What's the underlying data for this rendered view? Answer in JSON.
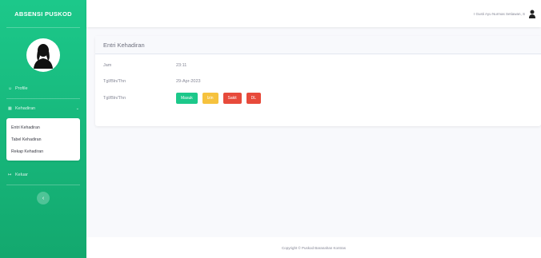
{
  "sidebar": {
    "brand": "ABSENSI PUSKOD",
    "items": [
      {
        "label": "Profile",
        "icon": "user-icon"
      },
      {
        "label": "Kehadiran",
        "icon": "calendar-icon"
      },
      {
        "label": "Keluar",
        "icon": "logout-icon"
      }
    ],
    "submenu": [
      "Entri Kehadiran",
      "Tabel Kehadiran",
      "Rekap Kehadiran"
    ],
    "toggle_icon": "chevron-left-icon"
  },
  "topbar": {
    "user_name": "I Gusti Ayu Nurmas Setiawan, S"
  },
  "card": {
    "title": "Entri Kehadiran",
    "rows": [
      {
        "label": "Jam",
        "value": "23:11"
      },
      {
        "label": "Tgl/Bln/Thn",
        "value": "29-Apr-2023"
      },
      {
        "label": "Tgl/Bln/Thn"
      }
    ],
    "buttons": [
      {
        "label": "Masuk",
        "color": "#1cc88a"
      },
      {
        "label": "Izin",
        "color": "#f6c23e"
      },
      {
        "label": "Sakit",
        "color": "#e74a3b"
      },
      {
        "label": "DL",
        "color": "#e74a3b"
      }
    ]
  },
  "footer": "Copyright © Puskod Baranahan Kontras",
  "colors": {
    "sidebar": "#1cc88a",
    "accent": "#1cc88a"
  }
}
